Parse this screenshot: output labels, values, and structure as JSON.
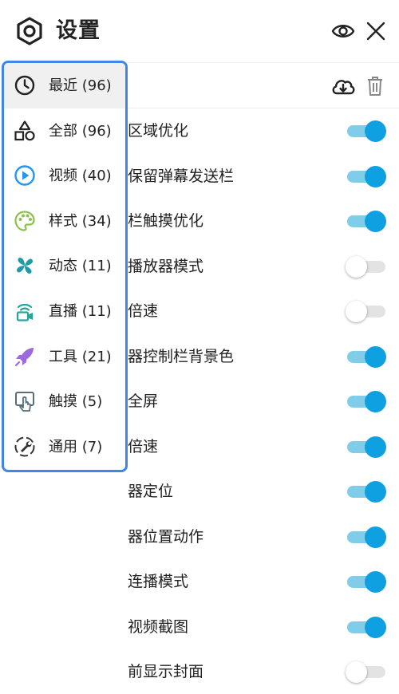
{
  "header": {
    "title": "设置",
    "icons": {
      "logo": "hexagon-gear-icon",
      "visibility": "eye-icon",
      "close": "close-icon"
    }
  },
  "toolbar": {
    "icons": {
      "cloud": "cloud-download-icon",
      "trash": "trash-icon"
    }
  },
  "menu": {
    "accent_color": "#3f86e8",
    "items": [
      {
        "label": "最近 (96)",
        "icon": "clock-icon",
        "color": "#222222",
        "selected": true
      },
      {
        "label": "全部 (96)",
        "icon": "shapes-icon",
        "color": "#222222",
        "selected": false
      },
      {
        "label": "视频 (40)",
        "icon": "play-circle-icon",
        "color": "#2196f3",
        "selected": false
      },
      {
        "label": "样式 (34)",
        "icon": "palette-icon",
        "color": "#8bc34a",
        "selected": false
      },
      {
        "label": "动态 (11)",
        "icon": "pinwheel-icon",
        "color": "#1e9aa8",
        "selected": false
      },
      {
        "label": "直播 (11)",
        "icon": "broadcast-icon",
        "color": "#26a69a",
        "selected": false
      },
      {
        "label": "工具 (21)",
        "icon": "rocket-icon",
        "color": "#9c6ade",
        "selected": false
      },
      {
        "label": "触摸 (5)",
        "icon": "touch-icon",
        "color": "#546e7a",
        "selected": false
      },
      {
        "label": "通用 (7)",
        "icon": "wrench-circle-icon",
        "color": "#333333",
        "selected": false
      }
    ]
  },
  "settings": [
    {
      "label": "区域优化",
      "on": true
    },
    {
      "label": "保留弹幕发送栏",
      "on": true
    },
    {
      "label": "栏触摸优化",
      "on": true
    },
    {
      "label": "播放器模式",
      "on": false
    },
    {
      "label": "倍速",
      "on": false
    },
    {
      "label": "器控制栏背景色",
      "on": true
    },
    {
      "label": "全屏",
      "on": true
    },
    {
      "label": "倍速",
      "on": true
    },
    {
      "label": "器定位",
      "on": true
    },
    {
      "label": "器位置动作",
      "on": true
    },
    {
      "label": "连播模式",
      "on": true
    },
    {
      "label": "视频截图",
      "on": true
    },
    {
      "label": "前显示封面",
      "on": false
    }
  ],
  "colors": {
    "toggle_on_knob": "#0ea0e0",
    "toggle_on_track": "#7fcde9",
    "toggle_off_track": "#e3e3e3"
  }
}
